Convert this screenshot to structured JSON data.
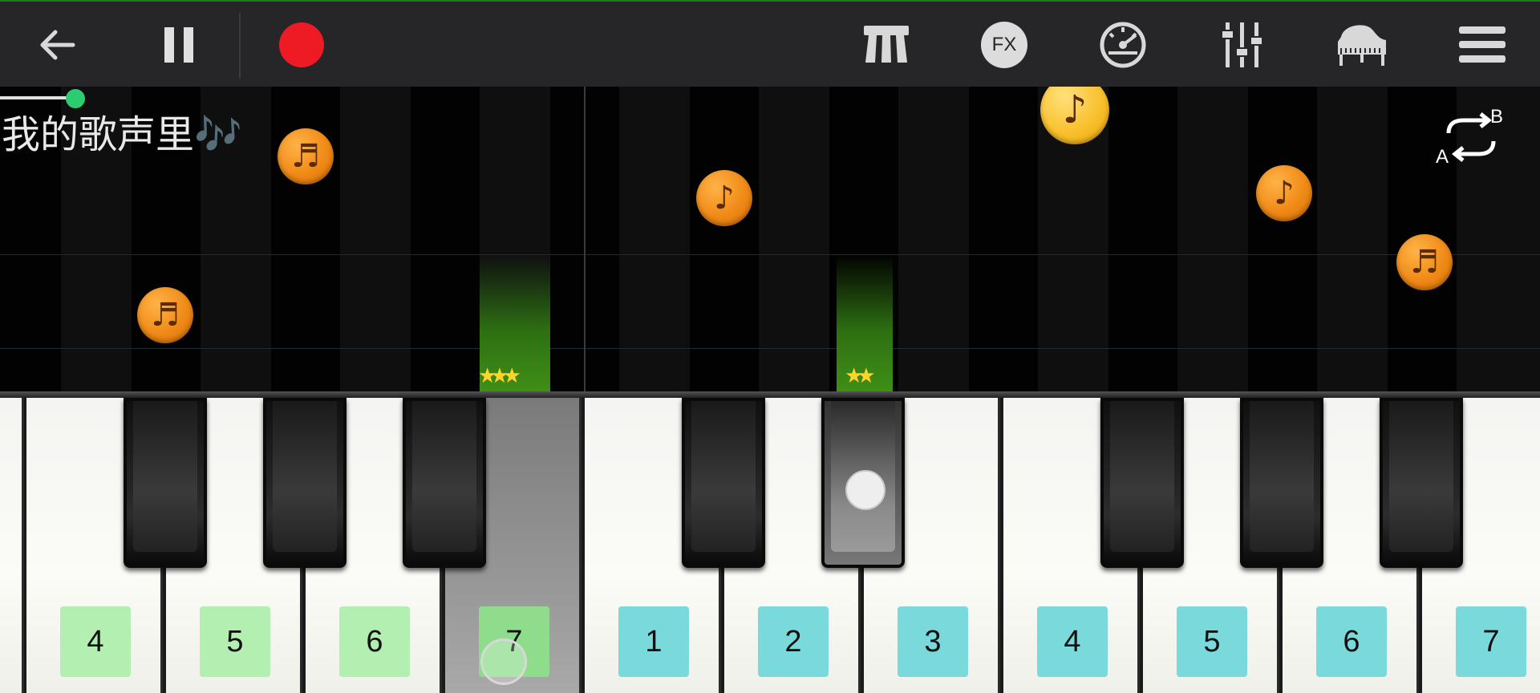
{
  "toolbar": {
    "icons": [
      "back-arrow-icon",
      "pause-icon",
      "record-icon",
      "key-count-icon",
      "fx-icon",
      "metronome-icon",
      "mixer-icon",
      "grand-piano-icon",
      "menu-icon"
    ],
    "fx_label": "FX",
    "record_color": "#ee1b24"
  },
  "song": {
    "title": "我的歌声里🎶"
  },
  "loop": {
    "a_label": "A",
    "b_label": "B"
  },
  "keyboard": {
    "white_keys": [
      {
        "label": "4",
        "color": "green"
      },
      {
        "label": "5",
        "color": "green"
      },
      {
        "label": "6",
        "color": "green"
      },
      {
        "label": "7",
        "color": "green",
        "pressed": true
      },
      {
        "label": "1",
        "color": "cyan"
      },
      {
        "label": "2",
        "color": "cyan"
      },
      {
        "label": "3",
        "color": "cyan"
      },
      {
        "label": "4",
        "color": "cyan"
      },
      {
        "label": "5",
        "color": "cyan"
      },
      {
        "label": "6",
        "color": "cyan"
      },
      {
        "label": "7",
        "color": "cyan"
      }
    ],
    "pressed_black_key_index": 4
  },
  "colors": {
    "toolbar_bg": "#262628",
    "note_orange": "#f08a17",
    "note_gold": "#f9c12e",
    "hit_green": "#3f8f17",
    "label_green": "#b3efb1",
    "label_cyan": "#7ad9da"
  }
}
